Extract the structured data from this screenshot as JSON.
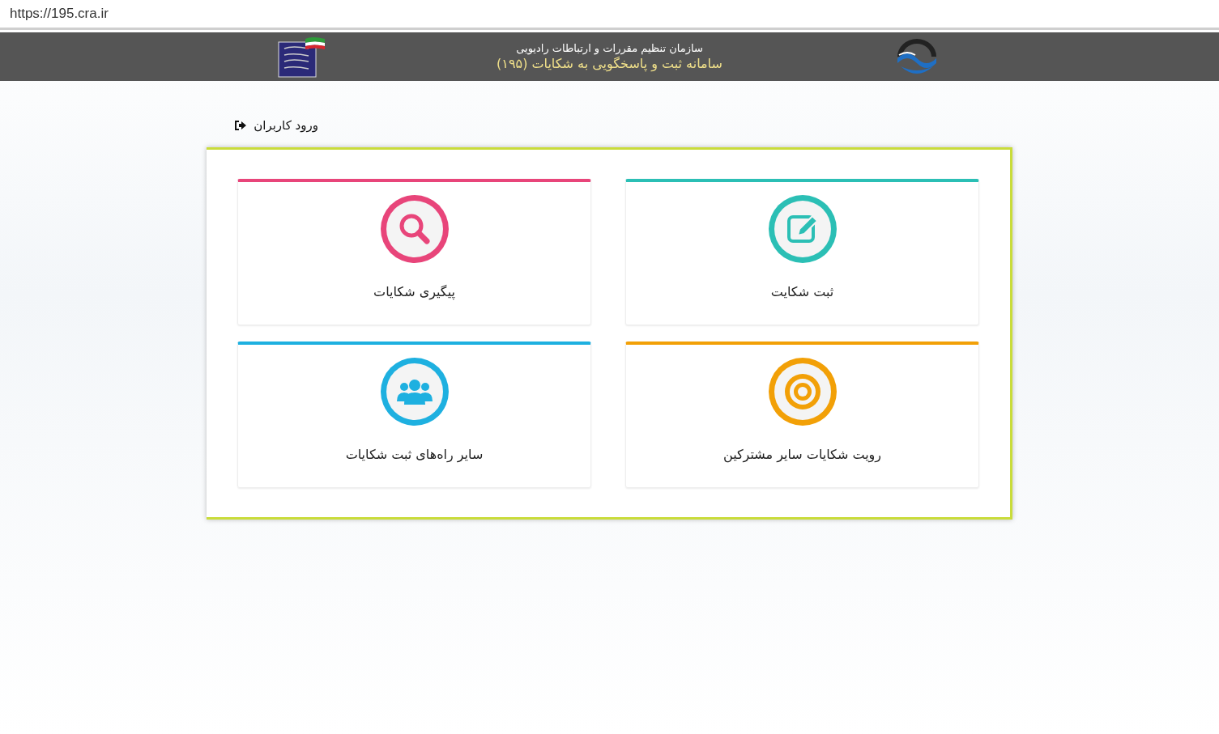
{
  "address_bar": {
    "url": "https://195.cra.ir"
  },
  "header": {
    "subtitle": "سازمان تنظیم مقررات و ارتباطات رادیویی",
    "title": "سامانه ثبت و پاسخگویی به شکایات (۱۹۵)"
  },
  "login_link": {
    "label": "ورود کاربران"
  },
  "tiles": [
    {
      "label": "ثبت شکایت",
      "kind": "edit",
      "color": "#2bbfb5"
    },
    {
      "label": "پیگیری شکایات",
      "kind": "search",
      "color": "#e8457a"
    },
    {
      "label": "رویت شکایات سایر مشترکین",
      "kind": "target",
      "color": "#f2a007"
    },
    {
      "label": "سایر راه‌های ثبت شکایات",
      "kind": "people",
      "color": "#1eb0e0"
    }
  ]
}
